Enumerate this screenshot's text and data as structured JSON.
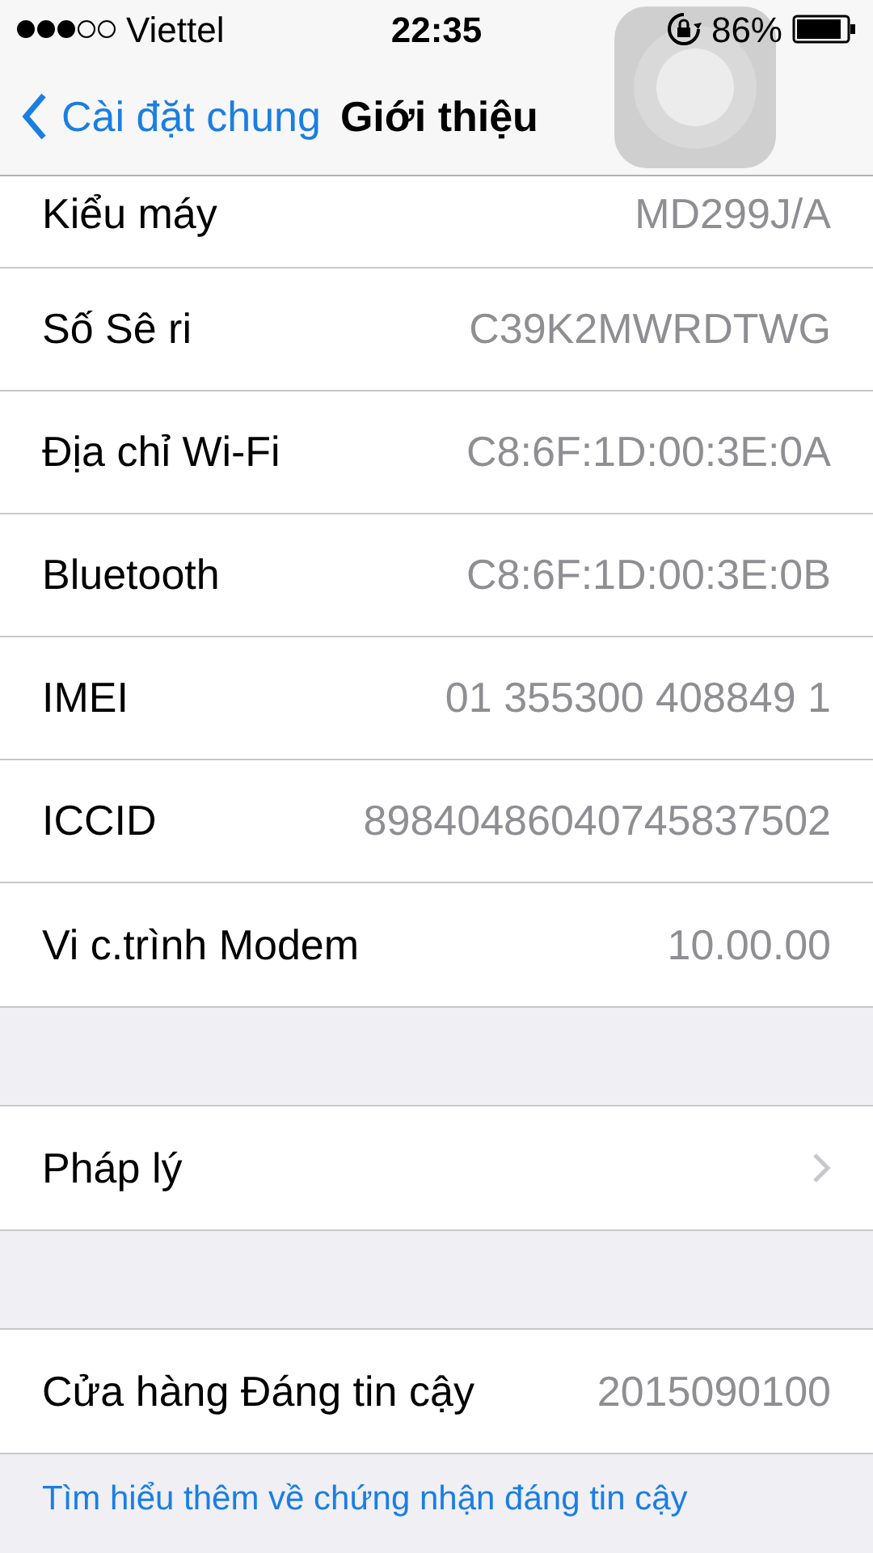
{
  "status_bar": {
    "carrier": "Viettel",
    "time": "22:35",
    "battery": "86%"
  },
  "nav": {
    "back": "Cài đặt chung",
    "title": "Giới thiệu"
  },
  "groups": [
    {
      "rows": [
        {
          "kind": "value",
          "label": "Kiểu máy",
          "value": "MD299J/A"
        },
        {
          "kind": "value",
          "label": "Số Sê ri",
          "value": "C39K2MWRDTWG"
        },
        {
          "kind": "value",
          "label": "Địa chỉ Wi-Fi",
          "value": "C8:6F:1D:00:3E:0A"
        },
        {
          "kind": "value",
          "label": "Bluetooth",
          "value": "C8:6F:1D:00:3E:0B"
        },
        {
          "kind": "value",
          "label": "IMEI",
          "value": "01 355300 408849 1"
        },
        {
          "kind": "value",
          "label": "ICCID",
          "value": "89840486040745837502"
        },
        {
          "kind": "value",
          "label": "Vi c.trình Modem",
          "value": "10.00.00"
        }
      ]
    },
    {
      "rows": [
        {
          "kind": "link",
          "label": "Pháp lý"
        }
      ]
    },
    {
      "rows": [
        {
          "kind": "value",
          "label": "Cửa hàng Đáng tin cậy",
          "value": "2015090100"
        }
      ]
    }
  ],
  "footer_link": "Tìm hiểu thêm về chứng nhận đáng tin cậy"
}
